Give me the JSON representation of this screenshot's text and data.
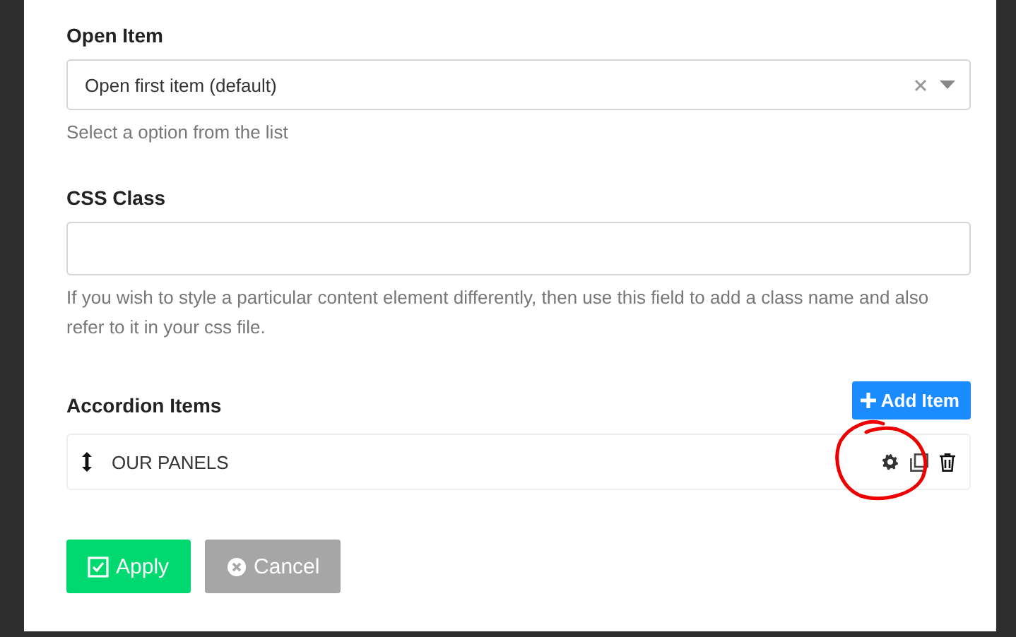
{
  "fields": [
    {
      "kind": "select",
      "label": "Open Item",
      "value": "Open first item (default)",
      "help": "Select a option from the list"
    },
    {
      "kind": "text",
      "label": "CSS Class",
      "help": "If you wish to style a particular content element differently, then use this field to add a class name and also refer to it in your css file."
    }
  ],
  "accordion": {
    "label": "Accordion Items",
    "add_button": "Add Item",
    "items": [
      {
        "title": "OUR PANELS"
      }
    ]
  },
  "buttons": [
    {
      "kind": "apply",
      "label": "Apply"
    },
    {
      "kind": "cancel",
      "label": "Cancel"
    }
  ]
}
